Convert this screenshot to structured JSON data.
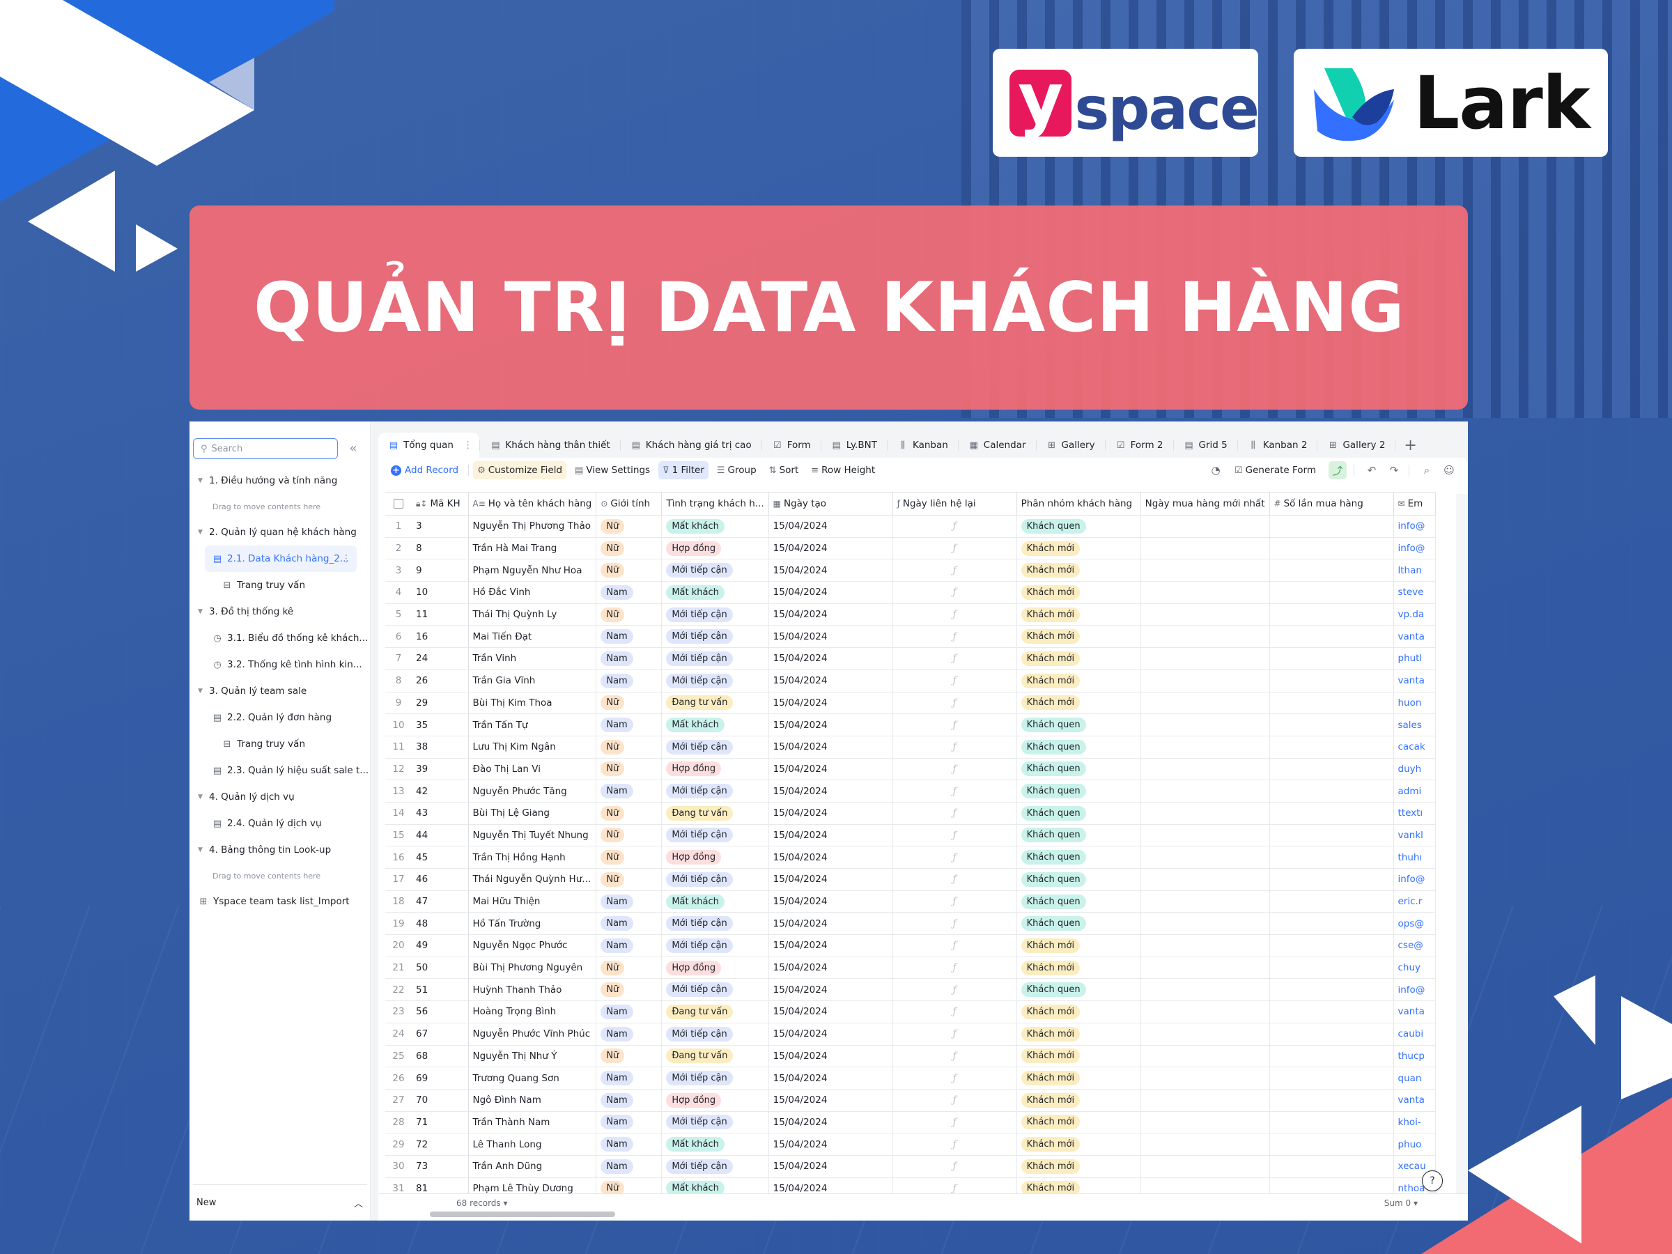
{
  "banner": {
    "title": "QUẢN TRỊ DATA KHÁCH HÀNG"
  },
  "logos": {
    "yspace_mark": "y",
    "yspace_text": "space",
    "lark_text": "Lark"
  },
  "sidebar": {
    "search_placeholder": "Search",
    "collapse_icon": "«",
    "items": [
      {
        "type": "group",
        "label": "1. Điều hướng và tính năng"
      },
      {
        "type": "hint",
        "label": "Drag to move contents here"
      },
      {
        "type": "group",
        "label": "2. Quản lý quan hệ khách hàng"
      },
      {
        "type": "leaf-active",
        "icon": "grid-table-icon",
        "label": "2.1. Data Khách hàng_2..."
      },
      {
        "type": "sub",
        "icon": "query-page-icon",
        "label": "Trang truy vấn"
      },
      {
        "type": "group",
        "label": "3. Đồ thị thống kê"
      },
      {
        "type": "leaf",
        "icon": "dashboard-icon",
        "label": "3.1. Biểu đồ thống kê khách..."
      },
      {
        "type": "leaf",
        "icon": "dashboard-icon",
        "label": "3.2. Thống kê tình hình kin..."
      },
      {
        "type": "group",
        "label": "3. Quản lý team sale"
      },
      {
        "type": "leaf",
        "icon": "grid-table-icon",
        "label": "2.2. Quản lý đơn hàng"
      },
      {
        "type": "sub",
        "icon": "query-page-icon",
        "label": "Trang truy vấn"
      },
      {
        "type": "leaf",
        "icon": "grid-table-icon",
        "label": "2.3. Quản lý hiệu suất sale t..."
      },
      {
        "type": "group",
        "label": "4. Quản lý dịch vụ"
      },
      {
        "type": "leaf",
        "icon": "grid-table-icon",
        "label": "2.4. Quản lý dịch vụ"
      },
      {
        "type": "group",
        "label": "4. Bảng thông tin Look-up"
      },
      {
        "type": "hint",
        "label": "Drag to move contents here"
      },
      {
        "type": "root",
        "icon": "import-table-icon",
        "label": "Yspace team task list_Import"
      }
    ],
    "footer_label": "New"
  },
  "tabs": [
    {
      "label": "Tổng quan",
      "icon": "grid-icon",
      "active": true
    },
    {
      "label": "Khách hàng thân thiết",
      "icon": "grid-icon"
    },
    {
      "label": "Khách hàng giá trị cao",
      "icon": "grid-icon"
    },
    {
      "label": "Form",
      "icon": "form-icon"
    },
    {
      "label": "Ly.BNT",
      "icon": "grid-icon"
    },
    {
      "label": "Kanban",
      "icon": "kanban-icon"
    },
    {
      "label": "Calendar",
      "icon": "calendar-icon"
    },
    {
      "label": "Gallery",
      "icon": "gallery-icon"
    },
    {
      "label": "Form 2",
      "icon": "form-icon"
    },
    {
      "label": "Grid 5",
      "icon": "grid-icon"
    },
    {
      "label": "Kanban 2",
      "icon": "kanban-icon"
    },
    {
      "label": "Gallery 2",
      "icon": "gallery-icon"
    }
  ],
  "toolbar": {
    "add_record": "Add Record",
    "customize_field": "Customize Field",
    "view_settings": "View Settings",
    "filter": "1 Filter",
    "group": "Group",
    "sort": "Sort",
    "row_height": "Row Height",
    "generate_form": "Generate Form"
  },
  "colors": {
    "accent": "#3370ff",
    "banner": "#f06b75",
    "pill_nu": "#fde3c9",
    "pill_nam": "#dfe6fb",
    "pill_mat_khach": "#c9f2ea",
    "pill_hop_dong": "#fddedf",
    "pill_moi_tiep_can": "#dfe6fb",
    "pill_dang_tu_van": "#fbedc0",
    "pill_khach_quen": "#c9f2ea",
    "pill_khach_moi": "#fbedc0"
  },
  "table": {
    "columns": [
      {
        "key": "ma_kh",
        "label": "Mã KH",
        "icon": "lock-sort-icon"
      },
      {
        "key": "ho_ten",
        "label": "Họ và tên khách hàng",
        "icon": "text-field-icon"
      },
      {
        "key": "gioi_tinh",
        "label": "Giới tính",
        "icon": "single-select-icon"
      },
      {
        "key": "tinh_trang",
        "label": "Tình trạng khách h...",
        "icon": ""
      },
      {
        "key": "ngay_tao",
        "label": "Ngày tạo",
        "icon": "calendar-field-icon"
      },
      {
        "key": "ngay_lien_he_lai",
        "label": "Ngày liên hệ lại",
        "icon": "formula-icon"
      },
      {
        "key": "phan_nhom",
        "label": "Phân nhóm khách hàng",
        "icon": ""
      },
      {
        "key": "ngay_mua_moi_nhat",
        "label": "Ngày mua hàng mới nhất",
        "icon": ""
      },
      {
        "key": "so_lan_mua",
        "label": "Số lần mua hàng",
        "icon": "number-icon"
      },
      {
        "key": "email",
        "label": "Em",
        "icon": "email-icon"
      }
    ],
    "formula_glyph": "ƒ",
    "rows": [
      {
        "n": 1,
        "ma_kh": "3",
        "ho_ten": "Nguyễn Thị Phương Thảo",
        "gioi_tinh": "Nữ",
        "tinh_trang": "Mất khách",
        "ngay_tao": "15/04/2024",
        "phan_nhom": "Khách quen",
        "email": "info@"
      },
      {
        "n": 2,
        "ma_kh": "8",
        "ho_ten": "Trần Hà Mai Trang",
        "gioi_tinh": "Nữ",
        "tinh_trang": "Hợp đồng",
        "ngay_tao": "15/04/2024",
        "phan_nhom": "Khách mới",
        "email": "info@"
      },
      {
        "n": 3,
        "ma_kh": "9",
        "ho_ten": "Phạm Nguyễn Như Hoa",
        "gioi_tinh": "Nữ",
        "tinh_trang": "Mới tiếp cận",
        "ngay_tao": "15/04/2024",
        "phan_nhom": "Khách mới",
        "email": "lthan"
      },
      {
        "n": 4,
        "ma_kh": "10",
        "ho_ten": "Hồ Đắc Vinh",
        "gioi_tinh": "Nam",
        "tinh_trang": "Mất khách",
        "ngay_tao": "15/04/2024",
        "phan_nhom": "Khách mới",
        "email": "steve"
      },
      {
        "n": 5,
        "ma_kh": "11",
        "ho_ten": "Thái Thị Quỳnh Ly",
        "gioi_tinh": "Nữ",
        "tinh_trang": "Mới tiếp cận",
        "ngay_tao": "15/04/2024",
        "phan_nhom": "Khách mới",
        "email": "vp.da"
      },
      {
        "n": 6,
        "ma_kh": "16",
        "ho_ten": "Mai Tiến Đạt",
        "gioi_tinh": "Nam",
        "tinh_trang": "Mới tiếp cận",
        "ngay_tao": "15/04/2024",
        "phan_nhom": "Khách mới",
        "email": "vanta"
      },
      {
        "n": 7,
        "ma_kh": "24",
        "ho_ten": "Trần Vinh",
        "gioi_tinh": "Nam",
        "tinh_trang": "Mới tiếp cận",
        "ngay_tao": "15/04/2024",
        "phan_nhom": "Khách mới",
        "email": "phutl"
      },
      {
        "n": 8,
        "ma_kh": "26",
        "ho_ten": "Trần Gia Vĩnh",
        "gioi_tinh": "Nam",
        "tinh_trang": "Mới tiếp cận",
        "ngay_tao": "15/04/2024",
        "phan_nhom": "Khách mới",
        "email": "vanta"
      },
      {
        "n": 9,
        "ma_kh": "29",
        "ho_ten": "Bùi Thị Kim Thoa",
        "gioi_tinh": "Nữ",
        "tinh_trang": "Đang tư vấn",
        "ngay_tao": "15/04/2024",
        "phan_nhom": "Khách mới",
        "email": "huon"
      },
      {
        "n": 10,
        "ma_kh": "35",
        "ho_ten": "Trần Tấn Tự",
        "gioi_tinh": "Nam",
        "tinh_trang": "Mất khách",
        "ngay_tao": "15/04/2024",
        "phan_nhom": "Khách quen",
        "email": "sales"
      },
      {
        "n": 11,
        "ma_kh": "38",
        "ho_ten": "Lưu Thị Kim Ngân",
        "gioi_tinh": "Nữ",
        "tinh_trang": "Mới tiếp cận",
        "ngay_tao": "15/04/2024",
        "phan_nhom": "Khách quen",
        "email": "cacak"
      },
      {
        "n": 12,
        "ma_kh": "39",
        "ho_ten": "Đào Thị Lan Vi",
        "gioi_tinh": "Nữ",
        "tinh_trang": "Hợp đồng",
        "ngay_tao": "15/04/2024",
        "phan_nhom": "Khách quen",
        "email": "duyh"
      },
      {
        "n": 13,
        "ma_kh": "42",
        "ho_ten": "Nguyễn Phước Tăng",
        "gioi_tinh": "Nam",
        "tinh_trang": "Mới tiếp cận",
        "ngay_tao": "15/04/2024",
        "phan_nhom": "Khách quen",
        "email": "admi"
      },
      {
        "n": 14,
        "ma_kh": "43",
        "ho_ten": "Bùi Thị Lệ Giang",
        "gioi_tinh": "Nữ",
        "tinh_trang": "Đang tư vấn",
        "ngay_tao": "15/04/2024",
        "phan_nhom": "Khách quen",
        "email": "ttextı"
      },
      {
        "n": 15,
        "ma_kh": "44",
        "ho_ten": "Nguyễn Thị Tuyết Nhung",
        "gioi_tinh": "Nữ",
        "tinh_trang": "Mới tiếp cận",
        "ngay_tao": "15/04/2024",
        "phan_nhom": "Khách quen",
        "email": "vankl"
      },
      {
        "n": 16,
        "ma_kh": "45",
        "ho_ten": "Trần Thị Hồng Hạnh",
        "gioi_tinh": "Nữ",
        "tinh_trang": "Hợp đồng",
        "ngay_tao": "15/04/2024",
        "phan_nhom": "Khách quen",
        "email": "thuhı"
      },
      {
        "n": 17,
        "ma_kh": "46",
        "ho_ten": "Thái Nguyễn Quỳnh Hư...",
        "gioi_tinh": "Nữ",
        "tinh_trang": "Mới tiếp cận",
        "ngay_tao": "15/04/2024",
        "phan_nhom": "Khách quen",
        "email": "info@"
      },
      {
        "n": 18,
        "ma_kh": "47",
        "ho_ten": "Mai Hữu Thiện",
        "gioi_tinh": "Nam",
        "tinh_trang": "Mất khách",
        "ngay_tao": "15/04/2024",
        "phan_nhom": "Khách quen",
        "email": "eric.r"
      },
      {
        "n": 19,
        "ma_kh": "48",
        "ho_ten": "Hồ Tấn Trường",
        "gioi_tinh": "Nam",
        "tinh_trang": "Mới tiếp cận",
        "ngay_tao": "15/04/2024",
        "phan_nhom": "Khách quen",
        "email": "ops@"
      },
      {
        "n": 20,
        "ma_kh": "49",
        "ho_ten": "Nguyễn Ngọc Phước",
        "gioi_tinh": "Nam",
        "tinh_trang": "Mới tiếp cận",
        "ngay_tao": "15/04/2024",
        "phan_nhom": "Khách mới",
        "email": "cse@"
      },
      {
        "n": 21,
        "ma_kh": "50",
        "ho_ten": "Bùi Thị Phương Nguyên",
        "gioi_tinh": "Nữ",
        "tinh_trang": "Hợp đồng",
        "ngay_tao": "15/04/2024",
        "phan_nhom": "Khách mới",
        "email": "chuy"
      },
      {
        "n": 22,
        "ma_kh": "51",
        "ho_ten": "Huỳnh Thanh Thảo",
        "gioi_tinh": "Nữ",
        "tinh_trang": "Mới tiếp cận",
        "ngay_tao": "15/04/2024",
        "phan_nhom": "Khách quen",
        "email": "info@"
      },
      {
        "n": 23,
        "ma_kh": "56",
        "ho_ten": "Hoàng Trọng Bình",
        "gioi_tinh": "Nam",
        "tinh_trang": "Đang tư vấn",
        "ngay_tao": "15/04/2024",
        "phan_nhom": "Khách mới",
        "email": "vanta"
      },
      {
        "n": 24,
        "ma_kh": "67",
        "ho_ten": "Nguyễn Phước Vĩnh Phúc",
        "gioi_tinh": "Nam",
        "tinh_trang": "Mới tiếp cận",
        "ngay_tao": "15/04/2024",
        "phan_nhom": "Khách mới",
        "email": "caubi"
      },
      {
        "n": 25,
        "ma_kh": "68",
        "ho_ten": "Nguyễn Thị Như Ý",
        "gioi_tinh": "Nữ",
        "tinh_trang": "Đang tư vấn",
        "ngay_tao": "15/04/2024",
        "phan_nhom": "Khách mới",
        "email": "thucp"
      },
      {
        "n": 26,
        "ma_kh": "69",
        "ho_ten": "Trương Quang Sơn",
        "gioi_tinh": "Nam",
        "tinh_trang": "Mới tiếp cận",
        "ngay_tao": "15/04/2024",
        "phan_nhom": "Khách mới",
        "email": "quan"
      },
      {
        "n": 27,
        "ma_kh": "70",
        "ho_ten": "Ngô Đình Nam",
        "gioi_tinh": "Nam",
        "tinh_trang": "Hợp đồng",
        "ngay_tao": "15/04/2024",
        "phan_nhom": "Khách mới",
        "email": "vanta"
      },
      {
        "n": 28,
        "ma_kh": "71",
        "ho_ten": "Trần Thành Nam",
        "gioi_tinh": "Nam",
        "tinh_trang": "Mới tiếp cận",
        "ngay_tao": "15/04/2024",
        "phan_nhom": "Khách mới",
        "email": "khoi-"
      },
      {
        "n": 29,
        "ma_kh": "72",
        "ho_ten": "Lê Thanh Long",
        "gioi_tinh": "Nam",
        "tinh_trang": "Mất khách",
        "ngay_tao": "15/04/2024",
        "phan_nhom": "Khách mới",
        "email": "phuo"
      },
      {
        "n": 30,
        "ma_kh": "73",
        "ho_ten": "Trần Anh Dũng",
        "gioi_tinh": "Nam",
        "tinh_trang": "Mới tiếp cận",
        "ngay_tao": "15/04/2024",
        "phan_nhom": "Khách mới",
        "email": "xecau"
      },
      {
        "n": 31,
        "ma_kh": "81",
        "ho_ten": "Phạm Lê Thùy Dương",
        "gioi_tinh": "Nữ",
        "tinh_trang": "Mất khách",
        "ngay_tao": "15/04/2024",
        "phan_nhom": "Khách mới",
        "email": "nthoa"
      }
    ]
  },
  "footer": {
    "records": "68 records ▾",
    "sum": "Sum 0 ▾",
    "help": "?"
  }
}
